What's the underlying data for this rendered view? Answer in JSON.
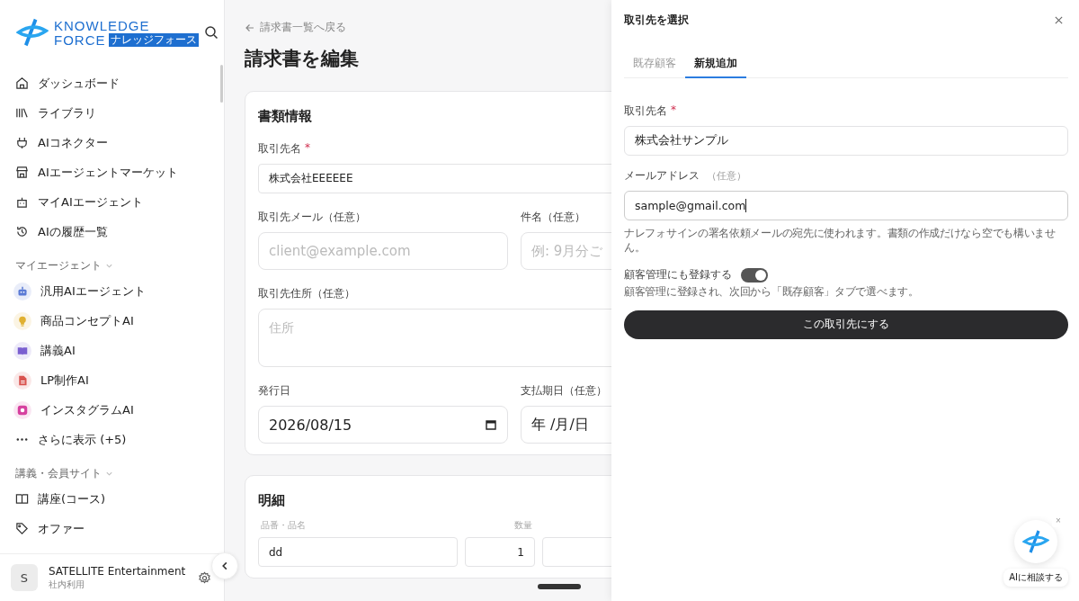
{
  "sidebar": {
    "logo": {
      "line1": "KNOWLEDGE",
      "line2": "FORCE",
      "badge": "ナレッジフォース"
    },
    "nav": [
      {
        "label": "ダッシュボード"
      },
      {
        "label": "ライブラリ"
      },
      {
        "label": "AIコネクター"
      },
      {
        "label": "AIエージェントマーケット"
      },
      {
        "label": "マイAIエージェント"
      },
      {
        "label": "AIの履歴一覧"
      }
    ],
    "agents_heading": "マイエージェント",
    "agents": [
      {
        "label": "汎用AIエージェント",
        "color": "#5b7bd5"
      },
      {
        "label": "商品コンセプトAI",
        "color": "#e0b030"
      },
      {
        "label": "講義AI",
        "color": "#7a5fd0"
      },
      {
        "label": "LP制作AI",
        "color": "#d9534f"
      },
      {
        "label": "インスタグラムAI",
        "color": "#d6409f"
      }
    ],
    "more": "さらに表示 (+5)",
    "course_heading": "講義・会員サイト",
    "course": [
      {
        "label": "講座(コース)"
      },
      {
        "label": "オファー"
      }
    ],
    "account": {
      "avatar": "S",
      "name": "SATELLITE Entertainment",
      "sub": "社内利用"
    }
  },
  "main": {
    "back_link": "請求書一覧へ戻る",
    "title": "請求書を編集",
    "doc_card": {
      "title": "書類情報",
      "client_name": {
        "label": "取引先名",
        "required_mark": "*",
        "value": "株式会社EEEEEE"
      },
      "client_email": {
        "label": "取引先メール（任意）",
        "placeholder": "client@example.com"
      },
      "subject": {
        "label": "件名（任意）",
        "placeholder": "例: 9月分ご"
      },
      "address": {
        "label": "取引先住所（任意）",
        "placeholder": "住所"
      },
      "issue_date": {
        "label": "発行日",
        "value": "2026/08/15"
      },
      "due_date": {
        "label": "支払期日（任意）",
        "value": "年 /月/日"
      }
    },
    "items_card": {
      "title": "明細",
      "columns": [
        "品番・品名",
        "数量"
      ],
      "row": {
        "name": "dd",
        "qty": "1"
      }
    }
  },
  "panel": {
    "title": "取引先を選択",
    "tabs": [
      {
        "label": "既存顧客",
        "selected": false
      },
      {
        "label": "新規追加",
        "selected": true
      }
    ],
    "name_field": {
      "label": "取引先名",
      "required_mark": "*",
      "value": "株式会社サンプル"
    },
    "email_field": {
      "label": "メールアドレス",
      "optional": "（任意）",
      "value": "sample@gmail.com",
      "hint": "ナレフォサインの署名依頼メールの宛先に使われます。書類の作成だけなら空でも構いません。"
    },
    "toggle": {
      "label": "顧客管理にも登録する",
      "on": true,
      "hint": "顧客管理に登録され、次回から「既存顧客」タブで選べます。"
    },
    "submit": "この取引先にする"
  },
  "assistant": {
    "close": "×",
    "label": "AIに相談する"
  }
}
